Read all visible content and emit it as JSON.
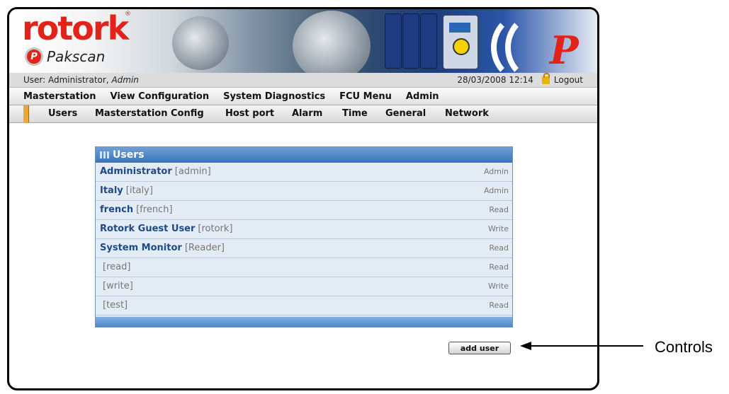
{
  "header": {
    "brand": "rotork",
    "product": "Pakscan"
  },
  "userbar": {
    "user_prefix": "User: Administrator,",
    "user_role": "Admin",
    "datetime": "28/03/2008 12:14",
    "logout": "Logout"
  },
  "main_menu": [
    "Masterstation",
    "View Configuration",
    "System Diagnostics",
    "FCU Menu",
    "Admin"
  ],
  "sub_menu": [
    "Users",
    "Masterstation Config",
    "Host port",
    "Alarm",
    "Time",
    "General",
    "Network"
  ],
  "panel": {
    "title": "Users",
    "rows": [
      {
        "name": "Administrator",
        "login": "[admin]",
        "role": "Admin"
      },
      {
        "name": "Italy",
        "login": "[italy]",
        "role": "Admin"
      },
      {
        "name": "french",
        "login": "[french]",
        "role": "Read"
      },
      {
        "name": "Rotork Guest User",
        "login": "[rotork]",
        "role": "Write"
      },
      {
        "name": "System Monitor",
        "login": "[Reader]",
        "role": "Read"
      },
      {
        "name": "",
        "login": "[read]",
        "role": "Read"
      },
      {
        "name": "",
        "login": "[write]",
        "role": "Write"
      },
      {
        "name": "",
        "login": "[test]",
        "role": "Read"
      }
    ]
  },
  "add_user_label": "add user",
  "annotation": "Controls",
  "colors": {
    "brand_red": "#e2231a",
    "panel_header": "#3a73b8",
    "link": "#1f4a85"
  }
}
